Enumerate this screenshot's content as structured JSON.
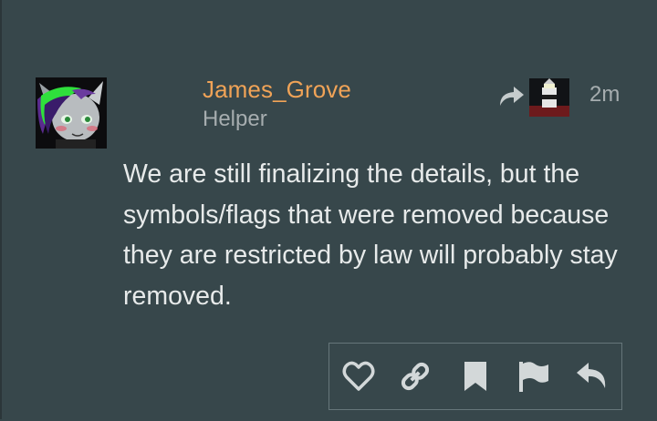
{
  "post": {
    "author": {
      "username": "James_Grove",
      "title": "Helper",
      "username_color": "#f0a357",
      "avatar_icon": "pony-avatar"
    },
    "reply_to": {
      "icon": "reply-to-arrow-icon",
      "avatar_icon": "lighthouse-avatar"
    },
    "timestamp": "2m",
    "body": "We are still finalizing the details, but the symbols/flags that were removed because they are restricted by law will probably stay removed."
  },
  "actions": [
    {
      "name": "like",
      "icon": "heart-icon"
    },
    {
      "name": "copy-link",
      "icon": "link-icon"
    },
    {
      "name": "bookmark",
      "icon": "bookmark-icon"
    },
    {
      "name": "flag",
      "icon": "flag-icon"
    },
    {
      "name": "reply",
      "icon": "reply-icon"
    }
  ],
  "colors": {
    "background": "#37474b",
    "text": "#e7eaea",
    "muted": "#a6adaf",
    "icon": "#d3d8d9"
  }
}
